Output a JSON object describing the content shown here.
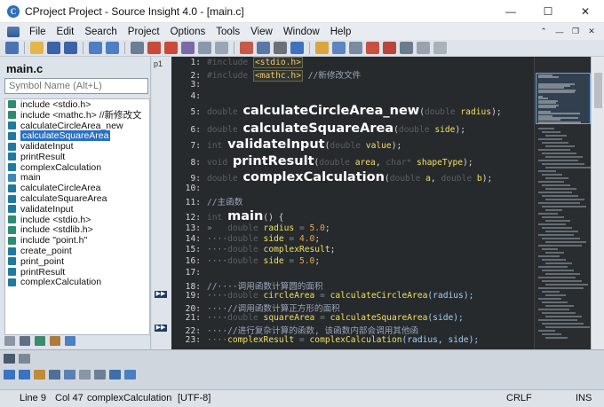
{
  "window": {
    "title": "CProject Project - Source Insight 4.0 - [main.c]",
    "app_icon": "source-insight-icon",
    "controls": [
      "—",
      "☐",
      "✕"
    ]
  },
  "menu": {
    "items": [
      "File",
      "Edit",
      "Search",
      "Project",
      "Options",
      "Tools",
      "View",
      "Window",
      "Help"
    ],
    "mdi_controls": [
      "⌃",
      "—",
      "❐",
      "✕"
    ]
  },
  "symbol_panel": {
    "file_title": "main.c",
    "search_placeholder": "Symbol Name (Alt+L)",
    "selected_index": 3,
    "items": [
      {
        "label": "include <stdio.h>",
        "icon": "include-icon"
      },
      {
        "label": "include <mathc.h> //新修改文",
        "icon": "include-icon"
      },
      {
        "label": "calculateCircleArea_new",
        "icon": "function-icon"
      },
      {
        "label": "calculateSquareArea",
        "icon": "function-icon"
      },
      {
        "label": "validateInput",
        "icon": "function-icon"
      },
      {
        "label": "printResult",
        "icon": "function-icon"
      },
      {
        "label": "complexCalculation",
        "icon": "function-icon"
      },
      {
        "label": "main",
        "icon": "main-icon"
      },
      {
        "label": "calculateCircleArea",
        "icon": "function-icon"
      },
      {
        "label": "calculateSquareArea",
        "icon": "function-icon"
      },
      {
        "label": "validateInput",
        "icon": "function-icon"
      },
      {
        "label": "include <stdio.h>",
        "icon": "include-icon"
      },
      {
        "label": "include <stdlib.h>",
        "icon": "include-icon"
      },
      {
        "label": "include \"point.h\"",
        "icon": "include-icon"
      },
      {
        "label": "create_point",
        "icon": "function-icon"
      },
      {
        "label": "print_point",
        "icon": "function-icon"
      },
      {
        "label": "printResult",
        "icon": "function-icon"
      },
      {
        "label": "complexCalculation",
        "icon": "function-icon"
      }
    ]
  },
  "gutter": {
    "page_label": "p1",
    "marker": "▶▶"
  },
  "editor": {
    "lines": [
      {
        "n": "1:",
        "tokens": [
          {
            "t": "#include ",
            "c": "kw-dim"
          },
          {
            "t": "<stdio.h>",
            "c": "inc-box"
          }
        ]
      },
      {
        "n": "2:",
        "tokens": [
          {
            "t": "#include ",
            "c": "kw-dim"
          },
          {
            "t": "<mathc.h>",
            "c": "inc-box"
          },
          {
            "t": " //新修改文件",
            "c": "cmt"
          }
        ]
      },
      {
        "n": "3:",
        "tokens": []
      },
      {
        "n": "4:",
        "tokens": []
      },
      {
        "n": "5:",
        "big": true,
        "tokens": [
          {
            "t": "double ",
            "c": "kw-dim"
          },
          {
            "t": "calculateCircleArea_new",
            "c": "func-big"
          },
          {
            "t": "(",
            "c": "plain"
          },
          {
            "t": "double ",
            "c": "kw-dim"
          },
          {
            "t": "radius",
            "c": "param"
          },
          {
            "t": ");",
            "c": "plain"
          }
        ]
      },
      {
        "n": "6:",
        "big": true,
        "tokens": [
          {
            "t": "double ",
            "c": "kw-dim"
          },
          {
            "t": "calculateSquareArea",
            "c": "func-big"
          },
          {
            "t": "(",
            "c": "plain"
          },
          {
            "t": "double ",
            "c": "kw-dim"
          },
          {
            "t": "side",
            "c": "param"
          },
          {
            "t": ");",
            "c": "plain"
          }
        ]
      },
      {
        "n": "7:",
        "big": true,
        "tokens": [
          {
            "t": "int ",
            "c": "kw-dim"
          },
          {
            "t": "validateInput",
            "c": "func-big"
          },
          {
            "t": "(",
            "c": "plain"
          },
          {
            "t": "double ",
            "c": "kw-dim"
          },
          {
            "t": "value",
            "c": "param"
          },
          {
            "t": ");",
            "c": "plain"
          }
        ]
      },
      {
        "n": "8:",
        "big": true,
        "tokens": [
          {
            "t": "void ",
            "c": "kw-dim"
          },
          {
            "t": "printResult",
            "c": "func-big"
          },
          {
            "t": "(",
            "c": "plain"
          },
          {
            "t": "double ",
            "c": "kw-dim"
          },
          {
            "t": "area",
            "c": "param"
          },
          {
            "t": ", ",
            "c": "plain"
          },
          {
            "t": "char* ",
            "c": "kw-dim"
          },
          {
            "t": "shapeType",
            "c": "param"
          },
          {
            "t": ");",
            "c": "plain"
          }
        ]
      },
      {
        "n": "9:",
        "big": true,
        "tokens": [
          {
            "t": "double ",
            "c": "kw-dim"
          },
          {
            "t": "complexCalculation",
            "c": "func-big"
          },
          {
            "t": "(",
            "c": "plain"
          },
          {
            "t": "double ",
            "c": "kw-dim"
          },
          {
            "t": "a",
            "c": "param"
          },
          {
            "t": ", ",
            "c": "plain"
          },
          {
            "t": "double ",
            "c": "kw-dim"
          },
          {
            "t": "b",
            "c": "param"
          },
          {
            "t": ");",
            "c": "plain"
          }
        ]
      },
      {
        "n": "10:",
        "tokens": []
      },
      {
        "n": "11:",
        "tokens": [
          {
            "t": "//主函数",
            "c": "cmt"
          }
        ]
      },
      {
        "n": "12:",
        "big": true,
        "tokens": [
          {
            "t": "int ",
            "c": "kw-dim"
          },
          {
            "t": "main",
            "c": "func-big"
          },
          {
            "t": "() {",
            "c": "plain"
          }
        ]
      },
      {
        "n": "13:",
        "tokens": [
          {
            "t": "»   ",
            "c": "op"
          },
          {
            "t": "double ",
            "c": "kw-dim"
          },
          {
            "t": "radius",
            "c": "var"
          },
          {
            "t": " = ",
            "c": "op"
          },
          {
            "t": "5.0",
            "c": "num"
          },
          {
            "t": ";",
            "c": "plain"
          }
        ]
      },
      {
        "n": "14:",
        "tokens": [
          {
            "t": "····",
            "c": "op"
          },
          {
            "t": "double ",
            "c": "kw-dim"
          },
          {
            "t": "side",
            "c": "var"
          },
          {
            "t": " = ",
            "c": "op"
          },
          {
            "t": "4.0",
            "c": "num"
          },
          {
            "t": ";",
            "c": "plain"
          }
        ]
      },
      {
        "n": "15:",
        "tokens": [
          {
            "t": "····",
            "c": "op"
          },
          {
            "t": "double ",
            "c": "kw-dim"
          },
          {
            "t": "complexResult",
            "c": "var"
          },
          {
            "t": ";",
            "c": "plain"
          }
        ]
      },
      {
        "n": "16:",
        "tokens": [
          {
            "t": "····",
            "c": "op"
          },
          {
            "t": "double ",
            "c": "kw-dim"
          },
          {
            "t": "side",
            "c": "var"
          },
          {
            "t": " = ",
            "c": "op"
          },
          {
            "t": "5.0",
            "c": "num"
          },
          {
            "t": ";",
            "c": "plain"
          }
        ]
      },
      {
        "n": "17:",
        "tokens": []
      },
      {
        "n": "18:",
        "tokens": [
          {
            "t": "//····调用函数计算圆的面积",
            "c": "cmt"
          }
        ]
      },
      {
        "n": "19:",
        "tokens": [
          {
            "t": "····",
            "c": "op"
          },
          {
            "t": "double ",
            "c": "kw-dim"
          },
          {
            "t": "circleArea",
            "c": "var"
          },
          {
            "t": " = ",
            "c": "op"
          },
          {
            "t": "calculateCircleArea",
            "c": "var"
          },
          {
            "t": "(radius);",
            "c": "fn-call"
          }
        ]
      },
      {
        "n": "20:",
        "tokens": [
          {
            "t": "····//调用函数计算正方形的面积",
            "c": "cmt"
          }
        ]
      },
      {
        "n": "21:",
        "tokens": [
          {
            "t": "····",
            "c": "op"
          },
          {
            "t": "double ",
            "c": "kw-dim"
          },
          {
            "t": "squareArea",
            "c": "var"
          },
          {
            "t": " = ",
            "c": "op"
          },
          {
            "t": "calculateSquareArea",
            "c": "var"
          },
          {
            "t": "(side);",
            "c": "fn-call"
          }
        ]
      },
      {
        "n": "22:",
        "tokens": [
          {
            "t": "····//进行复杂计算的函数, 该函数内部会调用其他函",
            "c": "cmt"
          }
        ]
      },
      {
        "n": "23:",
        "tokens": [
          {
            "t": "····",
            "c": "op"
          },
          {
            "t": "complexResult",
            "c": "var"
          },
          {
            "t": " = ",
            "c": "op"
          },
          {
            "t": "complexCalculation",
            "c": "var"
          },
          {
            "t": "(radius, side);",
            "c": "fn-call"
          }
        ]
      }
    ]
  },
  "statusbar": {
    "line": "Line 9",
    "col": "Col 47",
    "symbol": "complexCalculation",
    "encoding": "[UTF-8]",
    "eol": "CRLF",
    "mode": "INS"
  },
  "colors": {
    "editor_bg": "#272a2d",
    "selection": "#2a6fc4",
    "function_name": "#ffffff",
    "param": "#f1e05a",
    "comment": "#9aa4b8",
    "include_box": "#f0c674"
  }
}
